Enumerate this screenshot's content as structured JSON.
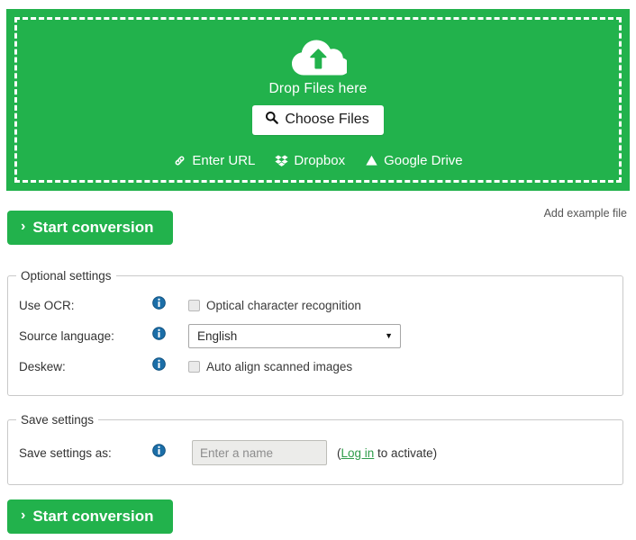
{
  "dropzone": {
    "cloud_icon": "cloud-upload-icon",
    "drop_text": "Drop Files here",
    "choose_files_label": "Choose Files",
    "choose_files_icon": "search-icon",
    "services": [
      {
        "label": "Enter URL",
        "icon": "link-icon"
      },
      {
        "label": "Dropbox",
        "icon": "dropbox-icon"
      },
      {
        "label": "Google Drive",
        "icon": "google-drive-icon"
      }
    ]
  },
  "actions": {
    "start_conversion_label": "Start conversion",
    "start_conversion_icon": "chevron-right-icon",
    "chevron": "›",
    "add_example_file_label": "Add example file"
  },
  "optional_settings": {
    "legend": "Optional settings",
    "rows": [
      {
        "label": "Use OCR:",
        "info_icon": "info-icon",
        "control": "checkbox",
        "checkbox_label": "Optical character recognition",
        "checked": false
      },
      {
        "label": "Source language:",
        "info_icon": "info-icon",
        "control": "select",
        "selected": "English",
        "caret": "▼"
      },
      {
        "label": "Deskew:",
        "info_icon": "info-icon",
        "control": "checkbox",
        "checkbox_label": "Auto align scanned images",
        "checked": false
      }
    ]
  },
  "save_settings": {
    "legend": "Save settings",
    "label": "Save settings as:",
    "info_icon": "info-icon",
    "input_value": "",
    "input_placeholder": "Enter a name",
    "note_open": "(",
    "note_link": "Log in",
    "note_rest": " to activate)"
  },
  "colors": {
    "brand_green": "#22b24c",
    "link_green": "#2e9c4a",
    "info_blue": "#1b6ea8",
    "panel_border": "#c9c9c9",
    "text": "#333333"
  }
}
